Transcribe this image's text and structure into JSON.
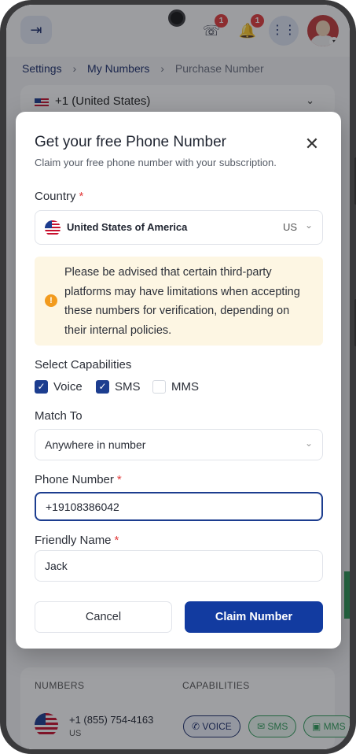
{
  "header": {
    "badge_support": "1",
    "badge_notifications": "1"
  },
  "breadcrumb": {
    "settings": "Settings",
    "my_numbers": "My Numbers",
    "current": "Purchase Number"
  },
  "background": {
    "country_select": "+1 (United States)",
    "table_headers": [
      "NUMBERS",
      "CAPABILITIES"
    ],
    "row": {
      "number": "+1 (855) 754-4163",
      "country_code": "US",
      "capabilities": [
        "VOICE",
        "SMS",
        "MMS"
      ]
    }
  },
  "modal": {
    "title": "Get your free Phone Number",
    "subtitle": "Claim your free phone number with your subscription.",
    "country_label": "Country",
    "required_mark": "*",
    "country_value": "United States of America",
    "country_code": "US",
    "notice": "Please be advised that certain third-party platforms may have limitations when accepting these numbers for verification, depending on their internal policies.",
    "capabilities_label": "Select Capabilities",
    "capabilities": [
      {
        "label": "Voice",
        "checked": true
      },
      {
        "label": "SMS",
        "checked": true
      },
      {
        "label": "MMS",
        "checked": false
      }
    ],
    "match_label": "Match To",
    "match_value": "Anywhere in number",
    "phone_label": "Phone Number",
    "phone_value": "+19108386042",
    "friendly_label": "Friendly Name",
    "friendly_value": "Jack",
    "cancel_label": "Cancel",
    "claim_label": "Claim Number"
  },
  "icons": [
    "menu-icon",
    "support-icon",
    "bell-icon",
    "apps-icon",
    "close-icon",
    "warning-icon",
    "chevron-down-icon",
    "checkbox-icon",
    "us-flag-icon"
  ],
  "colors": {
    "primary": "#123ba0",
    "required": "#e23b3b",
    "notice_bg": "#fdf6e3",
    "warning": "#f29b1e",
    "success": "#2f9e5a"
  }
}
